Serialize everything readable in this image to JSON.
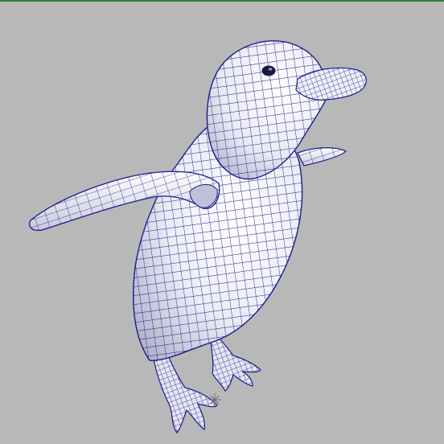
{
  "viewport": {
    "model": "penguin-wireframe",
    "display_mode": "wireframe-on-shaded",
    "background_color": "#b8b8b8",
    "wire_color": "#1c1c8c",
    "surface_color": "#eeeef6",
    "active_border_color": "#2e7a3e",
    "pivot_marker": "asterisk"
  }
}
